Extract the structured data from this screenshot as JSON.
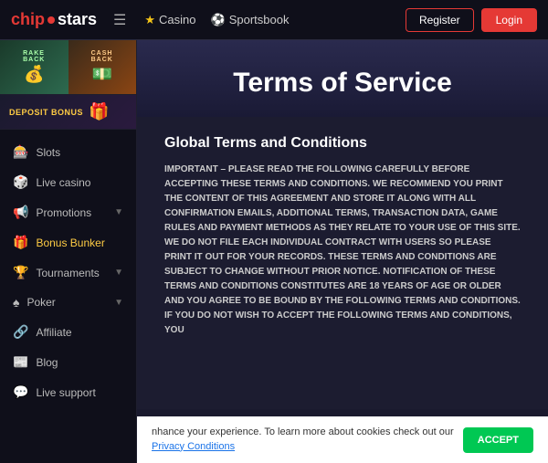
{
  "header": {
    "logo": {
      "chip": "chip",
      "stars": "stars"
    },
    "nav": [
      {
        "label": "Casino",
        "icon": "star"
      },
      {
        "label": "Sportsbook",
        "icon": "sport"
      }
    ],
    "register_label": "Register",
    "login_label": "Login"
  },
  "sidebar": {
    "promo_rakeback": "RAKE\nBACK",
    "promo_cashback": "CASH\nBACK",
    "deposit_bonus_label": "DEPOSIT BONUS",
    "items": [
      {
        "label": "Slots",
        "icon": "🎰",
        "id": "slots",
        "highlight": false
      },
      {
        "label": "Live casino",
        "icon": "🎲",
        "id": "live-casino",
        "highlight": false
      },
      {
        "label": "Promotions",
        "icon": "📢",
        "id": "promotions",
        "has_chevron": true,
        "highlight": false
      },
      {
        "label": "Bonus Bunker",
        "icon": "🎁",
        "id": "bonus-bunker",
        "highlight": true
      },
      {
        "label": "Tournaments",
        "icon": "🏆",
        "id": "tournaments",
        "has_chevron": true,
        "highlight": false
      },
      {
        "label": "Poker",
        "icon": "♠️",
        "id": "poker",
        "has_chevron": true,
        "highlight": false
      },
      {
        "label": "Affiliate",
        "icon": "🔗",
        "id": "affiliate",
        "highlight": false
      },
      {
        "label": "Blog",
        "icon": "📰",
        "id": "blog",
        "highlight": false
      },
      {
        "label": "Live support",
        "icon": "💬",
        "id": "live-support",
        "highlight": false
      }
    ]
  },
  "terms": {
    "title": "Terms of Service",
    "section_title": "Global Terms and Conditions",
    "body_text": "IMPORTANT – PLEASE READ THE FOLLOWING CAREFULLY BEFORE ACCEPTING THESE TERMS AND CONDITIONS. WE RECOMMEND YOU PRINT THE CONTENT OF THIS AGREEMENT AND STORE IT ALONG WITH ALL CONFIRMATION EMAILS, ADDITIONAL TERMS, TRANSACTION DATA, GAME RULES AND PAYMENT METHODS AS THEY RELATE TO YOUR USE OF THIS SITE. WE DO NOT FILE EACH INDIVIDUAL CONTRACT WITH USERS SO PLEASE PRINT IT OUT FOR YOUR RECORDS. THESE TERMS AND CONDITIONS ARE SUBJECT TO CHANGE WITHOUT PRIOR NOTICE. NOTIFICATION OF THESE TERMS AND CONDITIONS CONSTITUTES\n\nARE 18 YEARS OF AGE OR OLDER AND YOU AGREE TO BE BOUND BY THE FOLLOWING TERMS AND CONDITIONS. IF YOU DO NOT WISH TO ACCEPT THE FOLLOWING TERMS AND CONDITIONS, YOU"
  },
  "cookie": {
    "text": "nhance your experience. To learn more about cookies check out our ",
    "link_text": "Privacy Conditions",
    "accept_label": "ACCEPT"
  }
}
